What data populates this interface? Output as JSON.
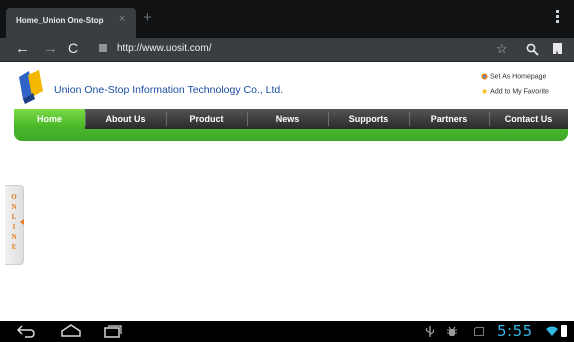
{
  "browser": {
    "tab_title": "Home_Union One-Stop",
    "tab_close_glyph": "×",
    "new_tab_glyph": "+",
    "url": "http://www.uosit.com/"
  },
  "icons": {
    "back": "arrow-left-icon",
    "forward": "arrow-right-icon",
    "reload": "reload-icon",
    "star": "star-icon",
    "search": "search-icon",
    "bookmarks": "bookmark-icon",
    "menu": "overflow-menu-icon"
  },
  "site": {
    "company_name": "Union One-Stop Information Technology Co., Ltd.",
    "set_homepage": "Set As Homepage",
    "add_favorite": "Add to My Favorite",
    "nav": [
      "Home",
      "About Us",
      "Product",
      "News",
      "Supports",
      "Partners",
      "Contact Us"
    ],
    "online_letters": [
      "O",
      "N",
      "L",
      "I",
      "N",
      "E"
    ]
  },
  "system": {
    "clock": "5:55"
  },
  "colors": {
    "accent_green": "#4cbb2d",
    "brand_blue": "#1b4ea0",
    "clock_blue": "#33b5e5",
    "online_orange": "#e87a1d"
  }
}
